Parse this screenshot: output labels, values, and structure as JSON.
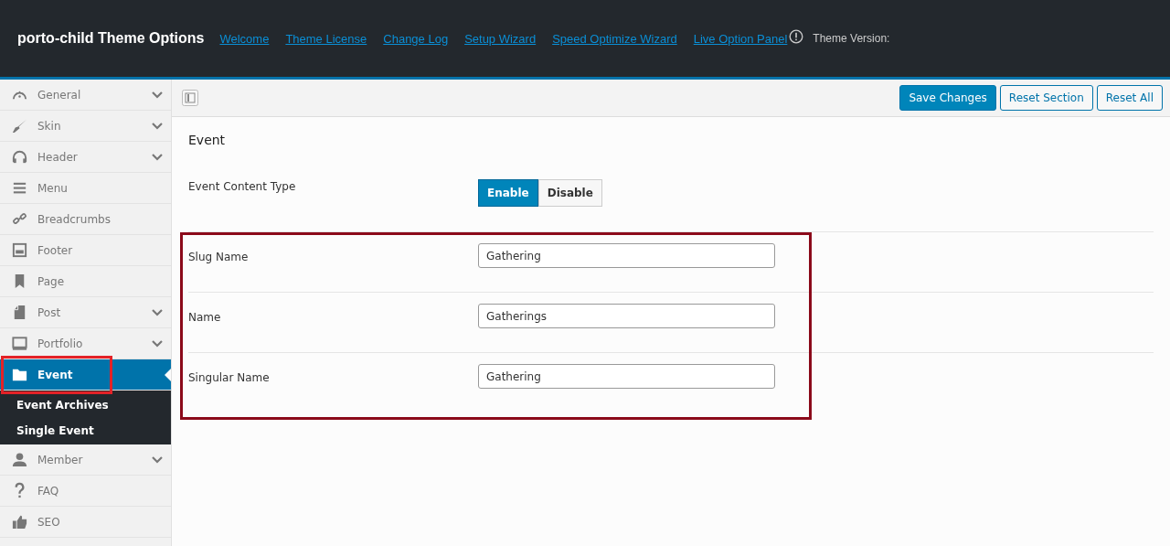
{
  "header": {
    "title": "porto-child Theme Options",
    "links": [
      "Welcome",
      "Theme License",
      "Change Log",
      "Setup Wizard",
      "Speed Optimize Wizard",
      "Live Option Panel"
    ],
    "version_label": "Theme Version:"
  },
  "sidebar": {
    "items": [
      {
        "label": "General",
        "expandable": true,
        "selected": false
      },
      {
        "label": "Skin",
        "expandable": true,
        "selected": false
      },
      {
        "label": "Header",
        "expandable": true,
        "selected": false
      },
      {
        "label": "Menu",
        "expandable": false,
        "selected": false
      },
      {
        "label": "Breadcrumbs",
        "expandable": false,
        "selected": false
      },
      {
        "label": "Footer",
        "expandable": false,
        "selected": false
      },
      {
        "label": "Page",
        "expandable": false,
        "selected": false
      },
      {
        "label": "Post",
        "expandable": true,
        "selected": false
      },
      {
        "label": "Portfolio",
        "expandable": true,
        "selected": false
      },
      {
        "label": "Event",
        "expandable": false,
        "selected": true,
        "children": [
          "Event Archives",
          "Single Event"
        ]
      },
      {
        "label": "Member",
        "expandable": true,
        "selected": false
      },
      {
        "label": "FAQ",
        "expandable": false,
        "selected": false
      },
      {
        "label": "SEO",
        "expandable": false,
        "selected": false
      }
    ]
  },
  "toolbar": {
    "buttons": [
      {
        "label": "Save Changes",
        "primary": true
      },
      {
        "label": "Reset Section",
        "primary": false
      },
      {
        "label": "Reset All",
        "primary": false
      }
    ]
  },
  "section": {
    "title": "Event",
    "fields": [
      {
        "kind": "toggle",
        "label": "Event Content Type",
        "options": [
          {
            "label": "Enable",
            "selected": true
          },
          {
            "label": "Disable",
            "selected": false
          }
        ]
      },
      {
        "kind": "text",
        "label": "Slug Name",
        "value": "Gathering"
      },
      {
        "kind": "text",
        "label": "Name",
        "value": "Gatherings"
      },
      {
        "kind": "text",
        "label": "Singular Name",
        "value": "Gathering"
      }
    ]
  }
}
